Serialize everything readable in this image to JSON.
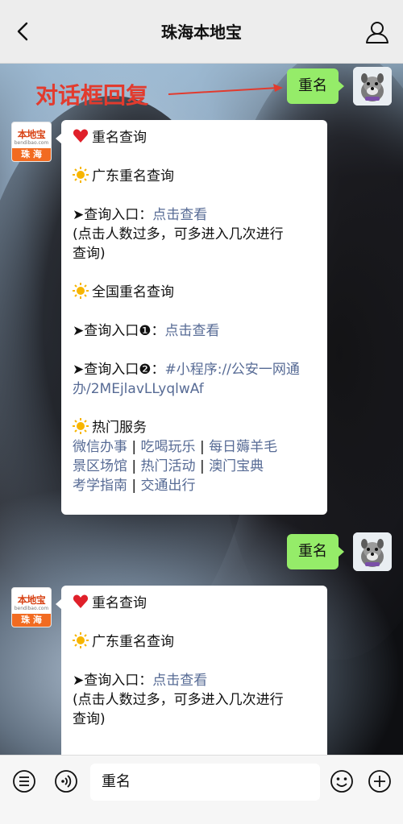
{
  "header": {
    "title": "珠海本地宝"
  },
  "annotation": {
    "text": "对话框回复"
  },
  "logo": {
    "top": "本地宝",
    "url": "bendibao.com",
    "bottom": "珠 海"
  },
  "messages": {
    "user1": "重名",
    "user2": "重名",
    "reply1": {
      "l1": "重名查询",
      "l2": "广东重名查询",
      "l3_prefix": "➤查询入口：",
      "l3_link": "点击查看",
      "l4": "(点击人数过多，可多进入几次进行",
      "l5": "查询)",
      "l6": "全国重名查询",
      "l7_prefix": "➤查询入口❶：",
      "l7_link": "点击查看",
      "l8_prefix": "➤查询入口❷：",
      "l8_link": "#小程序://公安一网通",
      "l9_link": "办/2MEjlavLLyqlwAf",
      "l10": "热门服务",
      "services_row1": [
        "微信办事",
        "吃喝玩乐",
        "每日薅羊毛"
      ],
      "services_row2": [
        "景区场馆",
        "热门活动",
        "澳门宝典"
      ],
      "services_row3": [
        "考学指南",
        "交通出行"
      ],
      "sep": "|"
    },
    "reply2": {
      "l1": "重名查询",
      "l2": "广东重名查询",
      "l3_prefix": "➤查询入口：",
      "l3_link": "点击查看",
      "l4": "(点击人数过多，可多进入几次进行",
      "l5": "查询)"
    }
  },
  "inputbar": {
    "value": "重名"
  },
  "icons": {
    "back": "chevron-left-icon",
    "profile": "user-icon",
    "keyboard": "menu-switch-icon",
    "voice": "voice-icon",
    "emoji": "emoji-icon",
    "more": "plus-icon"
  },
  "colors": {
    "bubble_green": "#95ec69",
    "link": "#576b95",
    "annotation": "#e23b2e"
  }
}
